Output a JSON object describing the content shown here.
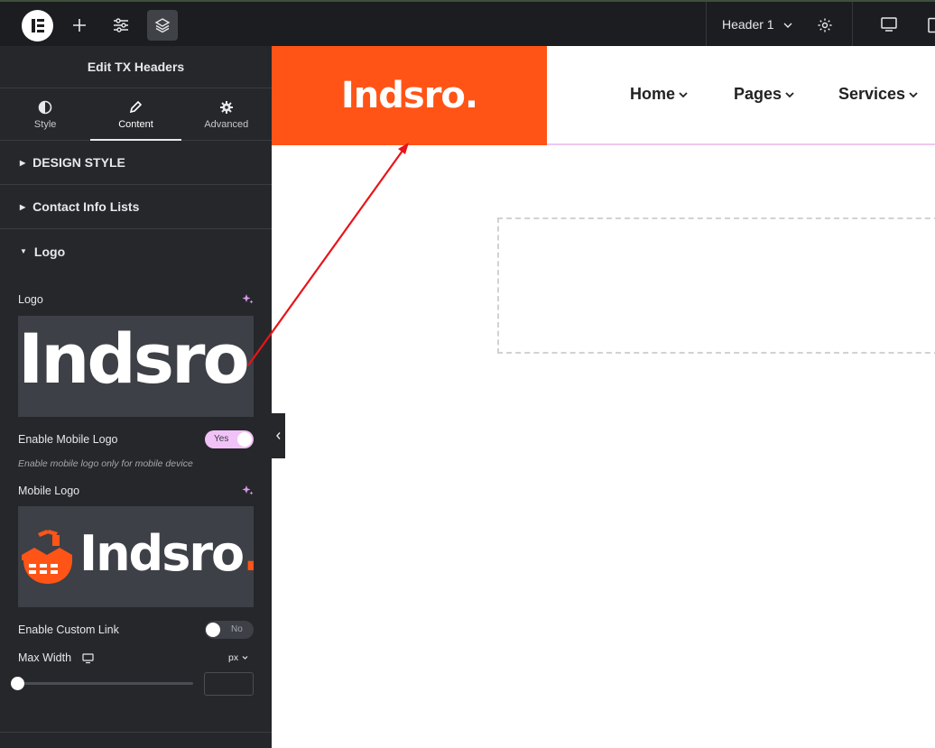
{
  "topbar": {
    "header_title": "Header 1",
    "icons": [
      "elementor-logo-icon",
      "add-icon",
      "sliders-icon",
      "layers-icon",
      "chevron-down-icon",
      "gear-icon",
      "desktop-icon",
      "tablet-icon"
    ]
  },
  "panel": {
    "title": "Edit TX Headers",
    "tabs": [
      {
        "label": "Style",
        "icon": "half-circle-icon"
      },
      {
        "label": "Content",
        "icon": "pencil-icon"
      },
      {
        "label": "Advanced",
        "icon": "gear-icon"
      }
    ],
    "active_tab": "Content",
    "sections": {
      "design_style": "DESIGN STYLE",
      "contact_info": "Contact Info Lists",
      "logo": "Logo"
    },
    "logo_field": {
      "label": "Logo",
      "image_text": "Indsro."
    },
    "enable_mobile_logo": {
      "label": "Enable Mobile Logo",
      "value": "Yes",
      "hint": "Enable mobile logo only for mobile device"
    },
    "mobile_logo_field": {
      "label": "Mobile Logo",
      "image_text": "Indsro",
      "image_dot": "."
    },
    "enable_custom_link": {
      "label": "Enable Custom Link",
      "value": "No"
    },
    "max_width": {
      "label": "Max Width",
      "unit": "px",
      "value": ""
    }
  },
  "canvas": {
    "site_logo": "Indsro.",
    "nav": [
      "Home",
      "Pages",
      "Services"
    ]
  },
  "colors": {
    "brand_orange": "#ff5416",
    "panel_bg": "#26272b",
    "toggle_on": "#f1c2f7",
    "arrow": "#e8141a"
  }
}
